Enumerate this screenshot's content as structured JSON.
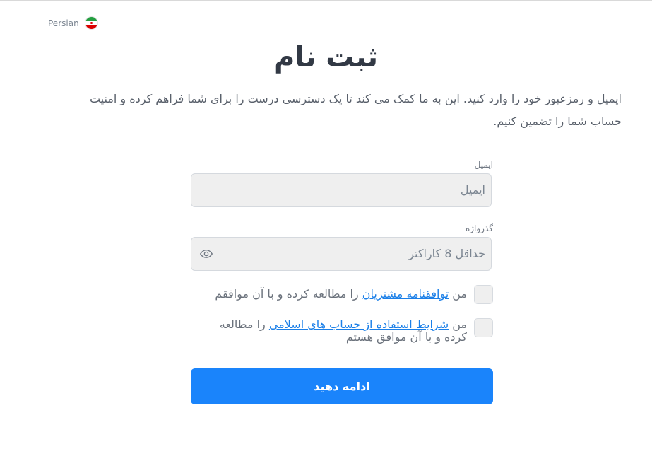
{
  "language": {
    "label": "Persian",
    "flag_icon": "iran-flag-icon"
  },
  "page": {
    "title": "ثبت نام",
    "description": "ایمیل و رمزعبور خود را وارد کنید. این به ما کمک می کند تا یک دسترسی درست را برای شما فراهم کرده و امنیت حساب شما را تضمین کنیم."
  },
  "form": {
    "email": {
      "label": "ایمیل",
      "placeholder": "ایمیل",
      "value": ""
    },
    "password": {
      "label": "گذرواژه",
      "placeholder": "حداقل 8 کاراکتر",
      "value": "",
      "toggle_icon": "eye-icon"
    },
    "agreements": [
      {
        "prefix": "من ",
        "link": "توافقنامه مشتریان",
        "suffix": " را مطالعه کرده و با آن موافقم",
        "checked": false
      },
      {
        "prefix": "من ",
        "link": "شرایط استفاده از حساب های اسلامی",
        "suffix": " را مطالعه کرده و با آن موافق هستم",
        "checked": false
      }
    ],
    "submit_label": "ادامه دهید"
  },
  "colors": {
    "primary": "#1a84fb",
    "link": "#1a7fe8",
    "input_bg": "#efefef"
  }
}
